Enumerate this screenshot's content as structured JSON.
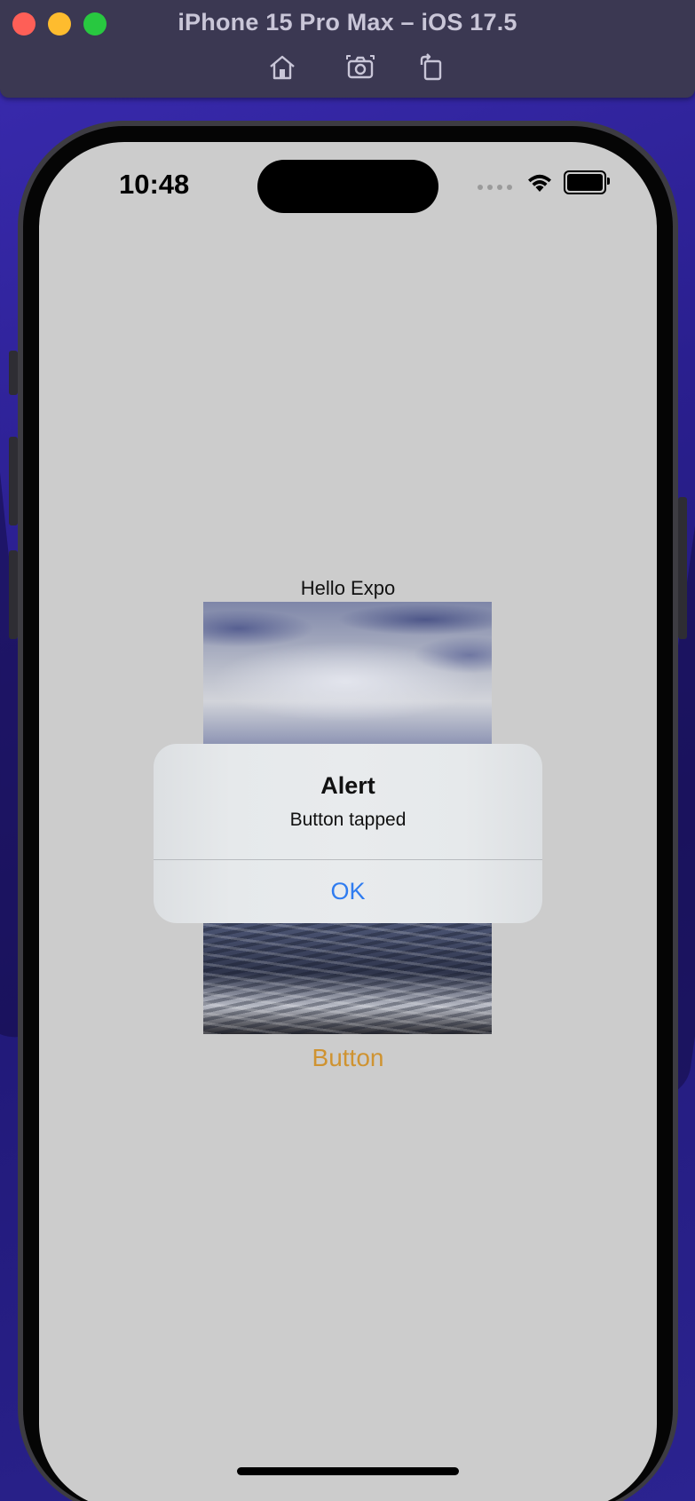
{
  "window": {
    "title": "iPhone 15 Pro Max – iOS 17.5",
    "toolbar": {
      "home": "home-icon",
      "screenshot": "camera-icon",
      "rotate": "rotate-icon"
    }
  },
  "status_bar": {
    "time": "10:48"
  },
  "app": {
    "greeting": "Hello Expo",
    "button_label": "Button",
    "button_color": "#cf9331"
  },
  "alert": {
    "title": "Alert",
    "message": "Button tapped",
    "ok_label": "OK",
    "ok_color": "#2f7cf0"
  },
  "colors": {
    "screen_background": "#cccccc",
    "wallpaper": "#2a1f8f"
  }
}
